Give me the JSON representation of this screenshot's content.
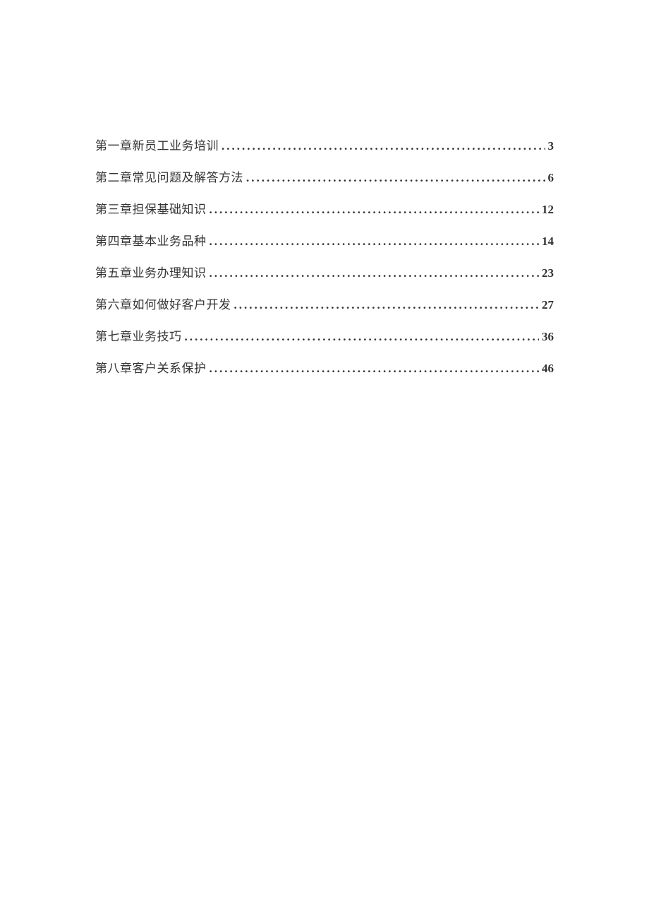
{
  "toc": {
    "entries": [
      {
        "title": "第一章新员工业务培训",
        "page": "3"
      },
      {
        "title": "第二章常见问题及解答方法",
        "page": "6"
      },
      {
        "title": "第三章担保基础知识",
        "page": "12"
      },
      {
        "title": "第四章基本业务品种",
        "page": "14"
      },
      {
        "title": "第五章业务办理知识",
        "page": "23"
      },
      {
        "title": "第六章如何做好客户开发",
        "page": "27"
      },
      {
        "title": "第七章业务技巧",
        "page": "36"
      },
      {
        "title": "第八章客户关系保护",
        "page": "46"
      }
    ]
  }
}
